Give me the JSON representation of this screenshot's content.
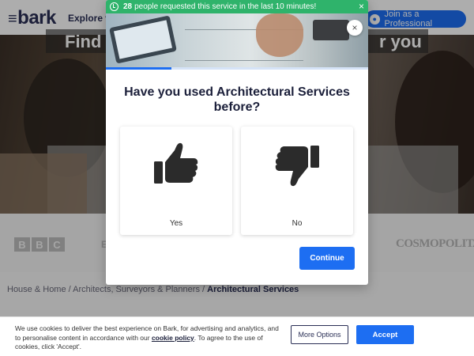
{
  "header": {
    "logo": "bark",
    "explore_label": "Explore",
    "join_label": "Join as a Professional"
  },
  "hero": {
    "title_left": "Find",
    "title_right": "r you"
  },
  "press_logos": {
    "bbc": [
      "B",
      "B",
      "C"
    ],
    "partial": "E",
    "cosmopolitan": "COSMOPOLITAN"
  },
  "breadcrumb": {
    "items": [
      "House & Home",
      "Architects, Surveyors & Planners"
    ],
    "separator": " / ",
    "current": "Architectural Services"
  },
  "modal": {
    "banner": {
      "count": "28",
      "text": "people requested this service in the last 10 minutes!",
      "close_glyph": "×"
    },
    "close_glyph": "×",
    "progress_fraction": 0.25,
    "question": "Have you used Architectural Services before?",
    "options": [
      {
        "label": "Yes",
        "icon": "thumbs-up-icon"
      },
      {
        "label": "No",
        "icon": "thumbs-down-icon"
      }
    ],
    "continue_label": "Continue"
  },
  "cookie": {
    "text_before": "We use cookies to deliver the best experience on Bark, for advertising and analytics, and to personalise content in accordance with our ",
    "link_label": "cookie policy",
    "text_after": ". To agree to the use of cookies, click 'Accept'.",
    "more_options_label": "More Options",
    "accept_label": "Accept"
  },
  "colors": {
    "brand_blue": "#1d6ef2",
    "banner_green": "#2fb36b",
    "navy": "#2a2f55"
  }
}
